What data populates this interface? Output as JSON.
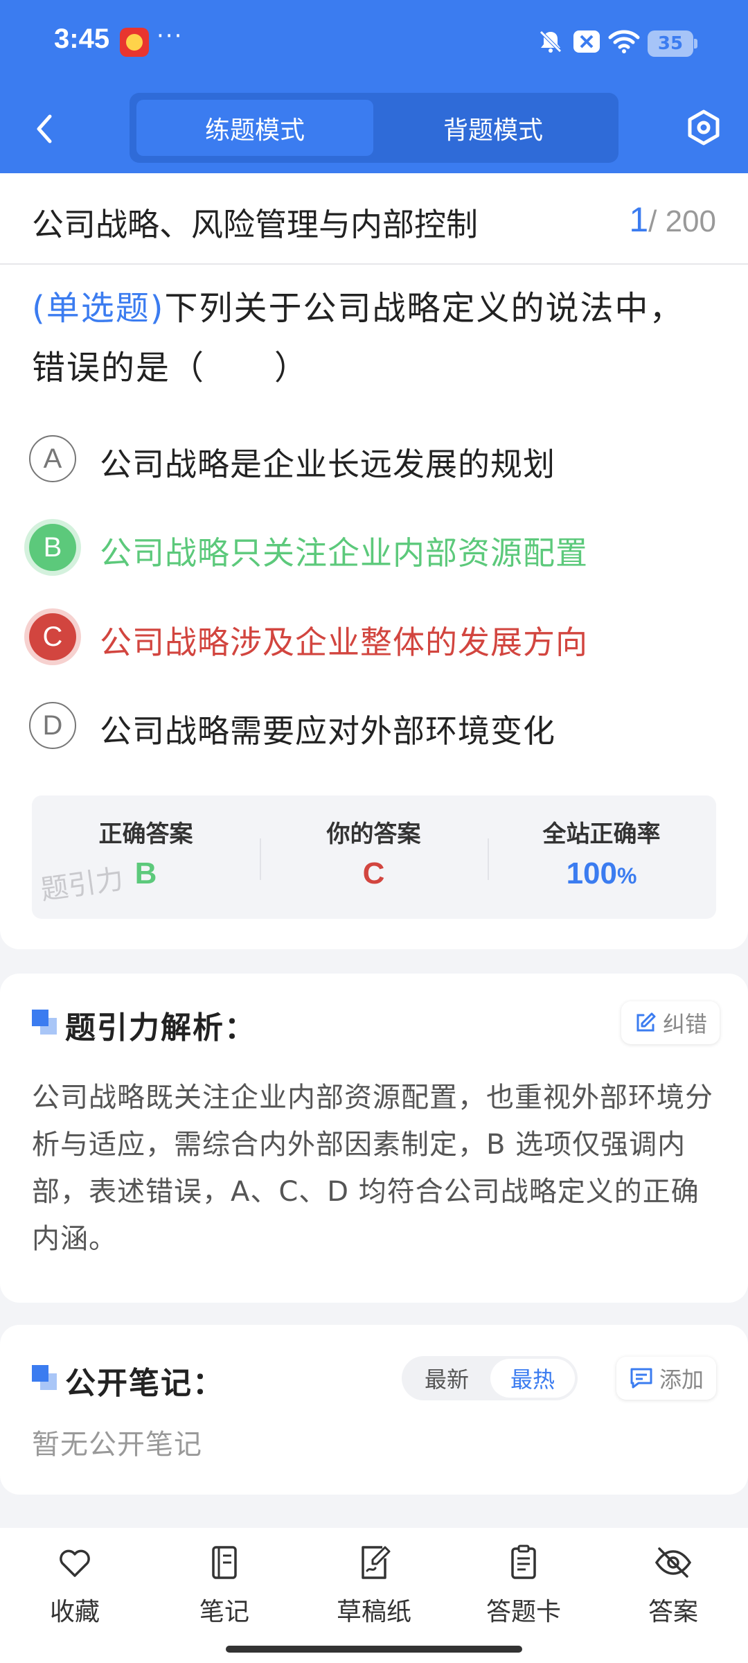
{
  "status_bar": {
    "time": "3:45",
    "more": "···",
    "battery": "35"
  },
  "header": {
    "modes": [
      {
        "label": "练题模式",
        "active": true
      },
      {
        "label": "背题模式",
        "active": false
      }
    ]
  },
  "question_card": {
    "chapter_title": "公司战略、风险管理与内部控制",
    "progress_current": "1",
    "progress_total": "/ 200",
    "question_type": "(单选题)",
    "question_text": "下列关于公司战略定义的说法中，错误的是（　　）",
    "options": [
      {
        "letter": "A",
        "text": "公司战略是企业长远发展的规划",
        "state": "normal"
      },
      {
        "letter": "B",
        "text": "公司战略只关注企业内部资源配置",
        "state": "correct"
      },
      {
        "letter": "C",
        "text": "公司战略涉及企业整体的发展方向",
        "state": "wrong"
      },
      {
        "letter": "D",
        "text": "公司战略需要应对外部环境变化",
        "state": "normal"
      }
    ],
    "answer_summary": {
      "correct_label": "正确答案",
      "correct_value": "B",
      "yours_label": "你的答案",
      "yours_value": "C",
      "rate_label": "全站正确率",
      "rate_value": "100",
      "rate_unit": "%"
    },
    "watermark": "题引力"
  },
  "analysis": {
    "title": "题引力解析：",
    "report_label": "纠错",
    "text": "公司战略既关注企业内部资源配置，也重视外部环境分析与适应，需综合内外部因素制定，B 选项仅强调内部，表述错误，A、C、D 均符合公司战略定义的正确内涵。"
  },
  "notes": {
    "title": "公开笔记：",
    "sort_options": [
      {
        "label": "最新",
        "active": false
      },
      {
        "label": "最热",
        "active": true
      }
    ],
    "add_label": "添加",
    "empty_text": "暂无公开笔记"
  },
  "bottom_bar": [
    {
      "label": "收藏",
      "icon": "heart-icon"
    },
    {
      "label": "笔记",
      "icon": "notebook-icon"
    },
    {
      "label": "草稿纸",
      "icon": "draft-paper-icon"
    },
    {
      "label": "答题卡",
      "icon": "answer-sheet-icon"
    },
    {
      "label": "答案",
      "icon": "eye-off-icon"
    }
  ],
  "colors": {
    "primary": "#3b7cf0",
    "correct": "#5cc97b",
    "wrong": "#d2453f"
  }
}
